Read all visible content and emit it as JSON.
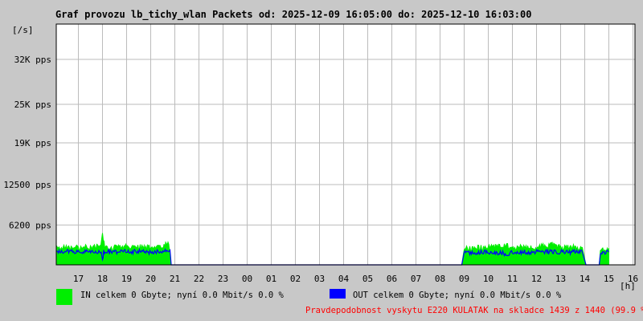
{
  "chart_data": {
    "type": "area",
    "title": "Graf provozu lb_tichy_wlan Packets od: 2025-12-09 16:05:00 do: 2025-12-10 16:03:00",
    "ylabel": "[/s]",
    "xlabel": "[h]",
    "ylim": [
      0,
      37500
    ],
    "y_ticks": [
      {
        "value": 6200,
        "label": "6200 pps"
      },
      {
        "value": 12500,
        "label": "12500 pps"
      },
      {
        "value": 19000,
        "label": "19K pps"
      },
      {
        "value": 25000,
        "label": "25K pps"
      },
      {
        "value": 32000,
        "label": "32K pps"
      }
    ],
    "x_ticks": [
      "17",
      "18",
      "19",
      "20",
      "21",
      "22",
      "23",
      "00",
      "01",
      "02",
      "03",
      "04",
      "05",
      "06",
      "07",
      "08",
      "09",
      "10",
      "11",
      "12",
      "13",
      "14",
      "15",
      "16"
    ],
    "grid": true,
    "series": [
      {
        "name": "IN",
        "color": "#00ee00",
        "points": [
          [
            16.1,
            2600
          ],
          [
            17,
            2700
          ],
          [
            17.9,
            2800
          ],
          [
            18,
            4600
          ],
          [
            18.1,
            2600
          ],
          [
            19,
            2800
          ],
          [
            20,
            2700
          ],
          [
            20.75,
            3200
          ],
          [
            20.85,
            0
          ],
          [
            21,
            0
          ],
          [
            22,
            0
          ],
          [
            23,
            0
          ],
          [
            24,
            0
          ],
          [
            25,
            0
          ],
          [
            26,
            0
          ],
          [
            27,
            0
          ],
          [
            28,
            0
          ],
          [
            29,
            0
          ],
          [
            30,
            0
          ],
          [
            31,
            0
          ],
          [
            32,
            0
          ],
          [
            32.9,
            0
          ],
          [
            33.0,
            2500
          ],
          [
            34,
            2700
          ],
          [
            34.8,
            3000
          ],
          [
            35,
            2700
          ],
          [
            36,
            2700
          ],
          [
            36.65,
            3100
          ],
          [
            37,
            2700
          ],
          [
            37.9,
            2700
          ],
          [
            38.05,
            0
          ],
          [
            38.6,
            0
          ],
          [
            38.65,
            2500
          ],
          [
            39,
            2600
          ]
        ]
      },
      {
        "name": "OUT",
        "color": "#0000ff",
        "points": [
          [
            16.1,
            2000
          ],
          [
            17,
            2100
          ],
          [
            17.95,
            2100
          ],
          [
            18,
            500
          ],
          [
            18.05,
            2000
          ],
          [
            19,
            2100
          ],
          [
            20,
            2000
          ],
          [
            20.8,
            2300
          ],
          [
            20.85,
            0
          ],
          [
            21,
            0
          ],
          [
            22,
            0
          ],
          [
            23,
            0
          ],
          [
            24,
            0
          ],
          [
            25,
            0
          ],
          [
            26,
            0
          ],
          [
            27,
            0
          ],
          [
            28,
            0
          ],
          [
            29,
            0
          ],
          [
            30,
            0
          ],
          [
            31,
            0
          ],
          [
            32,
            0
          ],
          [
            32.9,
            0
          ],
          [
            33.0,
            1900
          ],
          [
            34,
            2000
          ],
          [
            34.9,
            1700
          ],
          [
            35,
            2000
          ],
          [
            36,
            2000
          ],
          [
            37,
            2000
          ],
          [
            37.9,
            2000
          ],
          [
            38.05,
            0
          ],
          [
            38.6,
            0
          ],
          [
            38.65,
            1900
          ],
          [
            39,
            2000
          ]
        ]
      }
    ]
  },
  "legend": {
    "in_label": "IN celkem 0 Gbyte; nyní   0.0 Mbit/s 0.0 %",
    "out_label": "OUT celkem 0 Gbyte; nyní   0.0 Mbit/s 0.0 %",
    "in_color": "#00ee00",
    "out_color": "#0000ff"
  },
  "note": {
    "text": "Pravdepodobnost vyskytu E220 KULATAK na skladce 1439 z 1440 (99.9 %)",
    "color": "#ff0000"
  }
}
